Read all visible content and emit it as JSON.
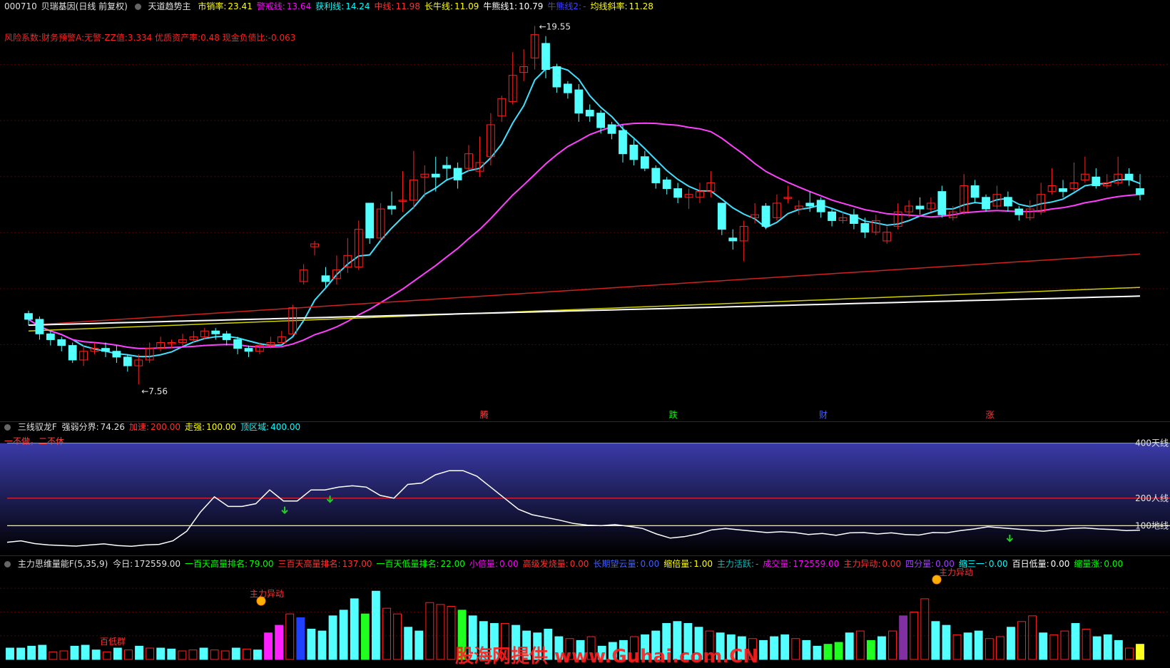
{
  "panel1": {
    "code": "000710",
    "name": "贝瑞基因(日线 前复权)",
    "indicator": "天道趋势主",
    "params": [
      {
        "label": "市销率:",
        "value": "23.41",
        "color": "#ffff00"
      },
      {
        "label": "警戒线:",
        "value": "13.64",
        "color": "#ff00ff"
      },
      {
        "label": "获利线:",
        "value": "14.24",
        "color": "#00ffff"
      },
      {
        "label": "中线:",
        "value": "11.98",
        "color": "#ff3030"
      },
      {
        "label": "长牛线:",
        "value": "11.09",
        "color": "#ffff00"
      },
      {
        "label": "牛熊线1:",
        "value": "10.79",
        "color": "#ffffff"
      },
      {
        "label": "牛熊线2:",
        "value": "-",
        "color": "#4040ff"
      },
      {
        "label": "均线斜率:",
        "value": "11.28",
        "color": "#ffff00"
      }
    ],
    "risk_text": "风险系数:财务预警A:无警-ZZ值:3.334 优质资产率:0.48 现金负债比:-0.063",
    "high_label": "19.55",
    "low_label": "7.56",
    "markers": [
      {
        "text": "腾",
        "color": "#ff4040"
      },
      {
        "text": "跌",
        "color": "#00ff00"
      },
      {
        "text": "财",
        "color": "#4060ff"
      },
      {
        "text": "涨",
        "color": "#ff4040"
      }
    ]
  },
  "panel2": {
    "name": "三线驭龙F",
    "params": [
      {
        "label": "强弱分界:",
        "value": "74.26",
        "color": "#e0e0e0"
      },
      {
        "label": "加速:",
        "value": "200.00",
        "color": "#ff3030"
      },
      {
        "label": "走强:",
        "value": "100.00",
        "color": "#ffff00"
      },
      {
        "label": "顶区域:",
        "value": "400.00",
        "color": "#00ffff"
      }
    ],
    "motto": "一不做，二不休",
    "line_labels": [
      "400天线",
      "200人线",
      "100地线"
    ]
  },
  "panel3": {
    "name": "主力思维量能F(5,35,9)",
    "params": [
      {
        "label": "今日:",
        "value": "172559.00",
        "color": "#e0e0e0"
      },
      {
        "label": "一百天高量排名:",
        "value": "79.00",
        "color": "#00ff00"
      },
      {
        "label": "三百天高量排名:",
        "value": "137.00",
        "color": "#ff3030"
      },
      {
        "label": "一百天低量排名:",
        "value": "22.00",
        "color": "#00ff00"
      },
      {
        "label": "小倍量:",
        "value": "0.00",
        "color": "#ff00ff"
      },
      {
        "label": "高级发烧量:",
        "value": "0.00",
        "color": "#ff3030"
      },
      {
        "label": "长期望云量:",
        "value": "0.00",
        "color": "#4060ff"
      },
      {
        "label": "缩倍量:",
        "value": "1.00",
        "color": "#ffff00"
      },
      {
        "label": "主力活跃:",
        "value": "-",
        "color": "#00bfbf"
      },
      {
        "label": "成交量:",
        "value": "172559.00",
        "color": "#ff00ff"
      },
      {
        "label": "主力异动:",
        "value": "0.00",
        "color": "#ff3030"
      },
      {
        "label": "四分量:",
        "value": "0.00",
        "color": "#a040ff"
      },
      {
        "label": "缩三一:",
        "value": "0.00",
        "color": "#00ffff"
      },
      {
        "label": "百日低量:",
        "value": "0.00",
        "color": "#ffffff"
      },
      {
        "label": "缩量涨:",
        "value": "0.00",
        "color": "#00ff00"
      }
    ],
    "annotations": [
      "百低群",
      "主力异动",
      "主力异动"
    ],
    "watermark": "股海网提供 www.Guhai.com.CN"
  },
  "colors": {
    "up": "#ff2020",
    "down": "#54ffff",
    "bg": "#000000",
    "ma_fast": "#40e0ff",
    "ma_slow": "#ff40ff",
    "ma_red": "#d02020",
    "ma_yellow": "#d0d000",
    "ma_white": "#ffffff"
  },
  "chart_data": [
    {
      "type": "candlestick",
      "title": "贝瑞基因(日线 前复权)",
      "ylim": [
        7.0,
        20.5
      ],
      "candles": [
        [
          10.0,
          9.8,
          10.1,
          9.6
        ],
        [
          9.8,
          9.3,
          9.9,
          9.1
        ],
        [
          9.3,
          9.1,
          9.4,
          8.9
        ],
        [
          9.1,
          8.9,
          9.2,
          8.7
        ],
        [
          8.9,
          8.4,
          9.0,
          8.3
        ],
        [
          8.4,
          8.7,
          8.9,
          8.2
        ],
        [
          8.7,
          8.8,
          9.0,
          8.6
        ],
        [
          8.8,
          8.7,
          9.0,
          8.5
        ],
        [
          8.7,
          8.5,
          8.9,
          8.3
        ],
        [
          8.5,
          8.2,
          8.6,
          8.0
        ],
        [
          8.2,
          8.4,
          8.6,
          7.56
        ],
        [
          8.4,
          8.8,
          9.0,
          8.3
        ],
        [
          8.8,
          9.0,
          9.2,
          8.7
        ],
        [
          9.0,
          9.0,
          9.1,
          8.8
        ],
        [
          9.0,
          9.1,
          9.3,
          8.9
        ],
        [
          9.1,
          9.2,
          9.4,
          9.0
        ],
        [
          9.2,
          9.4,
          9.5,
          9.1
        ],
        [
          9.4,
          9.3,
          9.5,
          9.1
        ],
        [
          9.3,
          9.1,
          9.4,
          8.9
        ],
        [
          9.1,
          8.8,
          9.2,
          8.6
        ],
        [
          8.8,
          8.7,
          8.9,
          8.5
        ],
        [
          8.7,
          8.9,
          9.0,
          8.6
        ],
        [
          8.9,
          9.0,
          9.2,
          8.8
        ],
        [
          9.0,
          9.2,
          9.4,
          9.0
        ],
        [
          9.3,
          10.2,
          10.3,
          9.3
        ],
        [
          11.1,
          11.5,
          11.7,
          11.0
        ],
        [
          12.3,
          12.4,
          12.5,
          12.0
        ],
        [
          11.3,
          11.1,
          11.6,
          10.9
        ],
        [
          11.2,
          11.5,
          12.0,
          11.0
        ],
        [
          11.6,
          12.0,
          12.6,
          11.4
        ],
        [
          11.6,
          12.9,
          13.2,
          11.5
        ],
        [
          13.8,
          12.6,
          13.8,
          12.4
        ],
        [
          12.6,
          13.6,
          13.8,
          12.5
        ],
        [
          13.7,
          13.6,
          14.2,
          13.4
        ],
        [
          13.9,
          13.9,
          14.9,
          13.5
        ],
        [
          13.9,
          14.6,
          15.6,
          13.6
        ],
        [
          14.7,
          14.8,
          15.1,
          14.0
        ],
        [
          14.8,
          14.7,
          15.4,
          14.2
        ],
        [
          15.1,
          15.0,
          15.4,
          14.6
        ],
        [
          15.0,
          14.6,
          15.2,
          14.3
        ],
        [
          15.0,
          15.5,
          15.8,
          14.9
        ],
        [
          14.9,
          15.2,
          16.1,
          14.7
        ],
        [
          15.4,
          16.5,
          16.9,
          15.1
        ],
        [
          16.8,
          17.4,
          17.5,
          16.6
        ],
        [
          17.3,
          18.2,
          19.0,
          17.2
        ],
        [
          18.3,
          18.5,
          19.1,
          18.0
        ],
        [
          18.8,
          19.6,
          19.9,
          18.4
        ],
        [
          19.3,
          18.4,
          19.55,
          18.1
        ],
        [
          18.5,
          17.8,
          18.6,
          17.6
        ],
        [
          17.9,
          17.6,
          18.0,
          17.4
        ],
        [
          17.7,
          16.9,
          17.9,
          16.6
        ],
        [
          17.0,
          16.8,
          17.2,
          16.6
        ],
        [
          16.9,
          16.4,
          17.0,
          16.2
        ],
        [
          16.5,
          16.2,
          16.6,
          16.0
        ],
        [
          16.3,
          15.5,
          16.5,
          15.2
        ],
        [
          15.8,
          15.3,
          16.0,
          15.1
        ],
        [
          15.4,
          15.0,
          15.6,
          14.9
        ],
        [
          15.0,
          14.5,
          15.1,
          14.3
        ],
        [
          14.6,
          14.3,
          14.7,
          14.1
        ],
        [
          14.3,
          14.0,
          14.5,
          13.8
        ],
        [
          14.0,
          14.1,
          14.3,
          13.6
        ],
        [
          14.0,
          14.2,
          14.5,
          13.8
        ],
        [
          14.2,
          14.5,
          14.9,
          14.0
        ],
        [
          13.8,
          12.9,
          13.8,
          12.7
        ],
        [
          12.6,
          12.5,
          12.9,
          12.2
        ],
        [
          12.5,
          13.0,
          13.2,
          11.8
        ],
        [
          13.3,
          13.4,
          13.8,
          13.1
        ],
        [
          13.7,
          13.0,
          13.8,
          12.9
        ],
        [
          13.3,
          13.8,
          14.1,
          13.2
        ],
        [
          14.0,
          14.0,
          14.4,
          13.8
        ],
        [
          13.6,
          13.7,
          13.9,
          13.4
        ],
        [
          13.8,
          13.7,
          14.2,
          13.5
        ],
        [
          13.9,
          13.5,
          14.0,
          13.3
        ],
        [
          13.5,
          13.2,
          13.6,
          13.0
        ],
        [
          13.2,
          13.3,
          13.5,
          13.1
        ],
        [
          13.4,
          13.1,
          13.6,
          12.9
        ],
        [
          13.1,
          12.8,
          13.3,
          12.6
        ],
        [
          12.8,
          13.2,
          13.4,
          12.7
        ],
        [
          12.5,
          12.8,
          13.0,
          12.4
        ],
        [
          13.0,
          13.5,
          13.8,
          12.9
        ],
        [
          13.5,
          13.7,
          13.9,
          13.3
        ],
        [
          13.7,
          13.6,
          14.0,
          13.4
        ],
        [
          13.6,
          13.8,
          14.0,
          13.5
        ],
        [
          14.2,
          13.4,
          14.4,
          13.3
        ],
        [
          13.3,
          13.5,
          13.7,
          13.2
        ],
        [
          13.5,
          14.4,
          14.8,
          13.4
        ],
        [
          14.4,
          14.0,
          14.6,
          13.8
        ],
        [
          14.0,
          13.6,
          14.1,
          13.5
        ],
        [
          13.7,
          14.1,
          14.4,
          13.6
        ],
        [
          14.0,
          13.7,
          14.2,
          13.5
        ],
        [
          13.6,
          13.4,
          13.7,
          13.2
        ],
        [
          13.3,
          13.6,
          13.9,
          13.2
        ],
        [
          13.5,
          14.1,
          14.5,
          13.4
        ],
        [
          14.2,
          14.4,
          15.0,
          14.1
        ],
        [
          14.3,
          14.2,
          14.6,
          14.0
        ],
        [
          14.3,
          14.5,
          15.2,
          14.2
        ],
        [
          14.6,
          14.8,
          15.4,
          14.5
        ],
        [
          14.7,
          14.4,
          15.0,
          14.3
        ],
        [
          14.4,
          14.5,
          14.8,
          14.3
        ],
        [
          14.5,
          14.8,
          15.4,
          14.4
        ],
        [
          14.8,
          14.6,
          15.0,
          14.4
        ],
        [
          14.3,
          14.1,
          14.8,
          13.9
        ]
      ]
    },
    {
      "type": "line",
      "title": "三线驭龙F",
      "ylim": [
        0,
        430
      ],
      "values": [
        40,
        45,
        35,
        30,
        28,
        26,
        30,
        34,
        28,
        25,
        30,
        32,
        45,
        80,
        150,
        205,
        170,
        170,
        180,
        230,
        190,
        190,
        230,
        230,
        240,
        245,
        240,
        210,
        200,
        250,
        255,
        285,
        300,
        300,
        280,
        240,
        200,
        160,
        140,
        130,
        120,
        108,
        102,
        100,
        104,
        98,
        90,
        70,
        55,
        60,
        70,
        85,
        90,
        85,
        80,
        75,
        78,
        75,
        68,
        72,
        65,
        74,
        75,
        70,
        74,
        68,
        66,
        75,
        74,
        82,
        88,
        96,
        92,
        88,
        84,
        80,
        85,
        90,
        92,
        88,
        86,
        82,
        84
      ]
    },
    {
      "type": "bar",
      "title": "主力思维量能F(5,35,9)",
      "ylim": [
        0,
        100
      ],
      "values": [
        12,
        12,
        14,
        15,
        8,
        9,
        14,
        15,
        10,
        8,
        12,
        10,
        14,
        12,
        12,
        11,
        9,
        10,
        12,
        10,
        9,
        12,
        11,
        10,
        28,
        36,
        48,
        44,
        32,
        30,
        46,
        52,
        64,
        48,
        72,
        54,
        48,
        34,
        30,
        60,
        58,
        56,
        52,
        46,
        40,
        38,
        38,
        36,
        30,
        28,
        32,
        24,
        22,
        20,
        24,
        14,
        18,
        20,
        24,
        26,
        30,
        38,
        40,
        38,
        34,
        30,
        28,
        26,
        24,
        22,
        20,
        24,
        26,
        22,
        20,
        14,
        16,
        18,
        28,
        30,
        20,
        24,
        30,
        46,
        50,
        64,
        40,
        36,
        26,
        28,
        30,
        22,
        24,
        34,
        40,
        46,
        28,
        26,
        30,
        38,
        32,
        24,
        26,
        20,
        12,
        16
      ],
      "colors": [
        "c",
        "c",
        "c",
        "c",
        "r",
        "r",
        "c",
        "c",
        "c",
        "r",
        "c",
        "r",
        "c",
        "r",
        "c",
        "c",
        "r",
        "r",
        "c",
        "r",
        "r",
        "c",
        "r",
        "c",
        "m",
        "m",
        "r",
        "b",
        "c",
        "c",
        "c",
        "c",
        "c",
        "g",
        "c",
        "r",
        "r",
        "c",
        "c",
        "r",
        "r",
        "r",
        "g",
        "c",
        "c",
        "c",
        "r",
        "c",
        "c",
        "c",
        "c",
        "c",
        "r",
        "c",
        "r",
        "c",
        "c",
        "c",
        "r",
        "c",
        "c",
        "c",
        "c",
        "c",
        "c",
        "r",
        "c",
        "c",
        "c",
        "r",
        "c",
        "c",
        "c",
        "r",
        "c",
        "c",
        "g",
        "g",
        "c",
        "r",
        "g",
        "c",
        "r",
        "p",
        "r",
        "r",
        "c",
        "c",
        "r",
        "c",
        "c",
        "r",
        "r",
        "c",
        "r",
        "r",
        "c",
        "r",
        "r",
        "c",
        "r",
        "c",
        "c",
        "c",
        "r",
        "y"
      ]
    }
  ]
}
